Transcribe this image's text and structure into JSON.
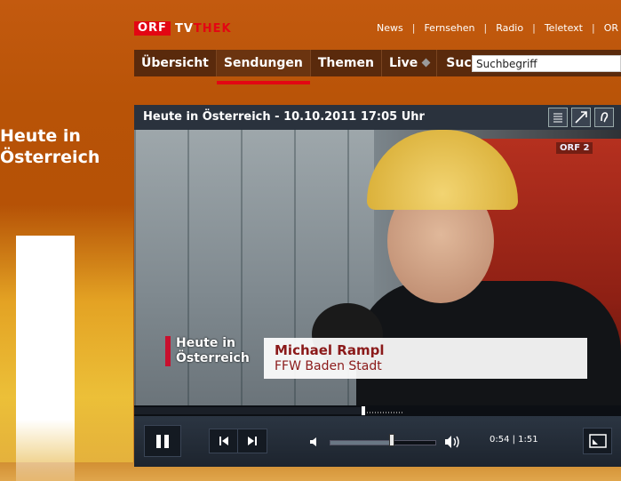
{
  "side": {
    "title_line1": "Heute in",
    "title_line2": "Österreich"
  },
  "brand": {
    "orf": "ORF",
    "tv": "TV",
    "thek": "THEK"
  },
  "toplinks": [
    "News",
    "Fernsehen",
    "Radio",
    "Teletext",
    "OR"
  ],
  "nav": {
    "items": [
      {
        "label": "Übersicht"
      },
      {
        "label": "Sendungen",
        "active": true
      },
      {
        "label": "Themen"
      },
      {
        "label": "Live"
      }
    ],
    "search_label": "Suche",
    "search_value": "Suchbegriff"
  },
  "player": {
    "title": "Heute in Österreich - 10.10.2011 17:05 Uhr",
    "tools": [
      "text-icon",
      "popout-icon",
      "audio-description-icon"
    ],
    "channel_bug": "ORF 2",
    "show_logo_line1": "Heute in",
    "show_logo_line2": "Österreich",
    "lower_third_name": "Michael Rampl",
    "lower_third_org": "FFW Baden Stadt",
    "progress": 0.47,
    "volume": 0.58,
    "time": "0:54 | 1:51"
  }
}
